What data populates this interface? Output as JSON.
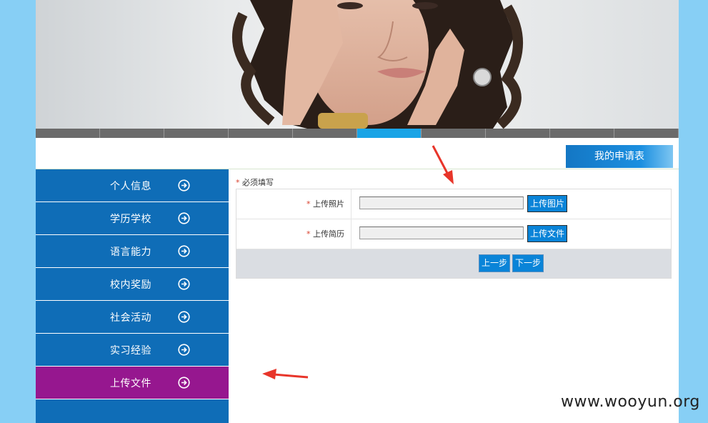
{
  "banner": {
    "slider_tab_count": 10,
    "active_tab_index": 5,
    "active_color": "#1aa4e6"
  },
  "header": {
    "my_application_label": "我的申请表"
  },
  "sidebar": {
    "items": [
      {
        "label": "个人信息",
        "active": false
      },
      {
        "label": "学历学校",
        "active": false
      },
      {
        "label": "语言能力",
        "active": false
      },
      {
        "label": "校内奖励",
        "active": false
      },
      {
        "label": "社会活动",
        "active": false
      },
      {
        "label": "实习经验",
        "active": false
      },
      {
        "label": "上传文件",
        "active": true
      }
    ],
    "bg_color": "#0f6db7",
    "active_color": "#96178f"
  },
  "form": {
    "required_star": "*",
    "required_note": "必须填写",
    "rows": [
      {
        "star": "*",
        "label": "上传照片",
        "button": "上传图片"
      },
      {
        "star": "*",
        "label": "上传简历",
        "button": "上传文件"
      }
    ],
    "prev_label": "上一步",
    "next_label": "下一步"
  },
  "watermark": "www.wooyun.org",
  "colors": {
    "page_bg": "#87cff5",
    "button_blue": "#0a84d8",
    "annotation_red": "#e8352a"
  }
}
